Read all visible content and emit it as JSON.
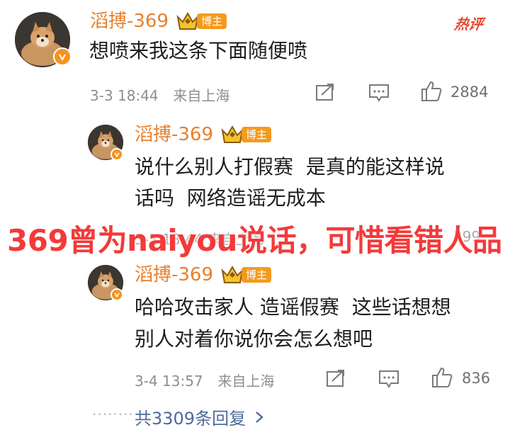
{
  "hot_label": "热评",
  "main_comment": {
    "username": "滔搏-369",
    "badge": "博主",
    "text": "想喷来我这条下面随便喷",
    "date": "3-3 18:44",
    "location": "来自上海",
    "likes": "2884"
  },
  "replies": [
    {
      "username": "滔搏-369",
      "badge": "博主",
      "text_line1": "说什么别人打假赛  是真的能这样说",
      "text_line2": "话吗  网络造谣无成本"
    },
    {
      "username": "滔搏-369",
      "badge": "博主",
      "text_line1": "哈哈攻击家人 造谣假赛  这些话想想",
      "text_line2": "别人对着你说你会怎么想吧",
      "date": "3-4 13:57",
      "location": "来自上海",
      "likes": "836"
    }
  ],
  "overlay_caption": "369曾为naiyou说话，可惜看错人品",
  "more_replies": "共3309条回复",
  "colors": {
    "username": "#e87f2a",
    "badge": "#f39a1e",
    "overlay": "#f43a3a",
    "link": "#4c6b9a"
  },
  "icons": [
    "avatar-dog",
    "crown-icon",
    "share-icon",
    "comment-icon",
    "thumbs-up-icon",
    "chevron-right-icon"
  ]
}
